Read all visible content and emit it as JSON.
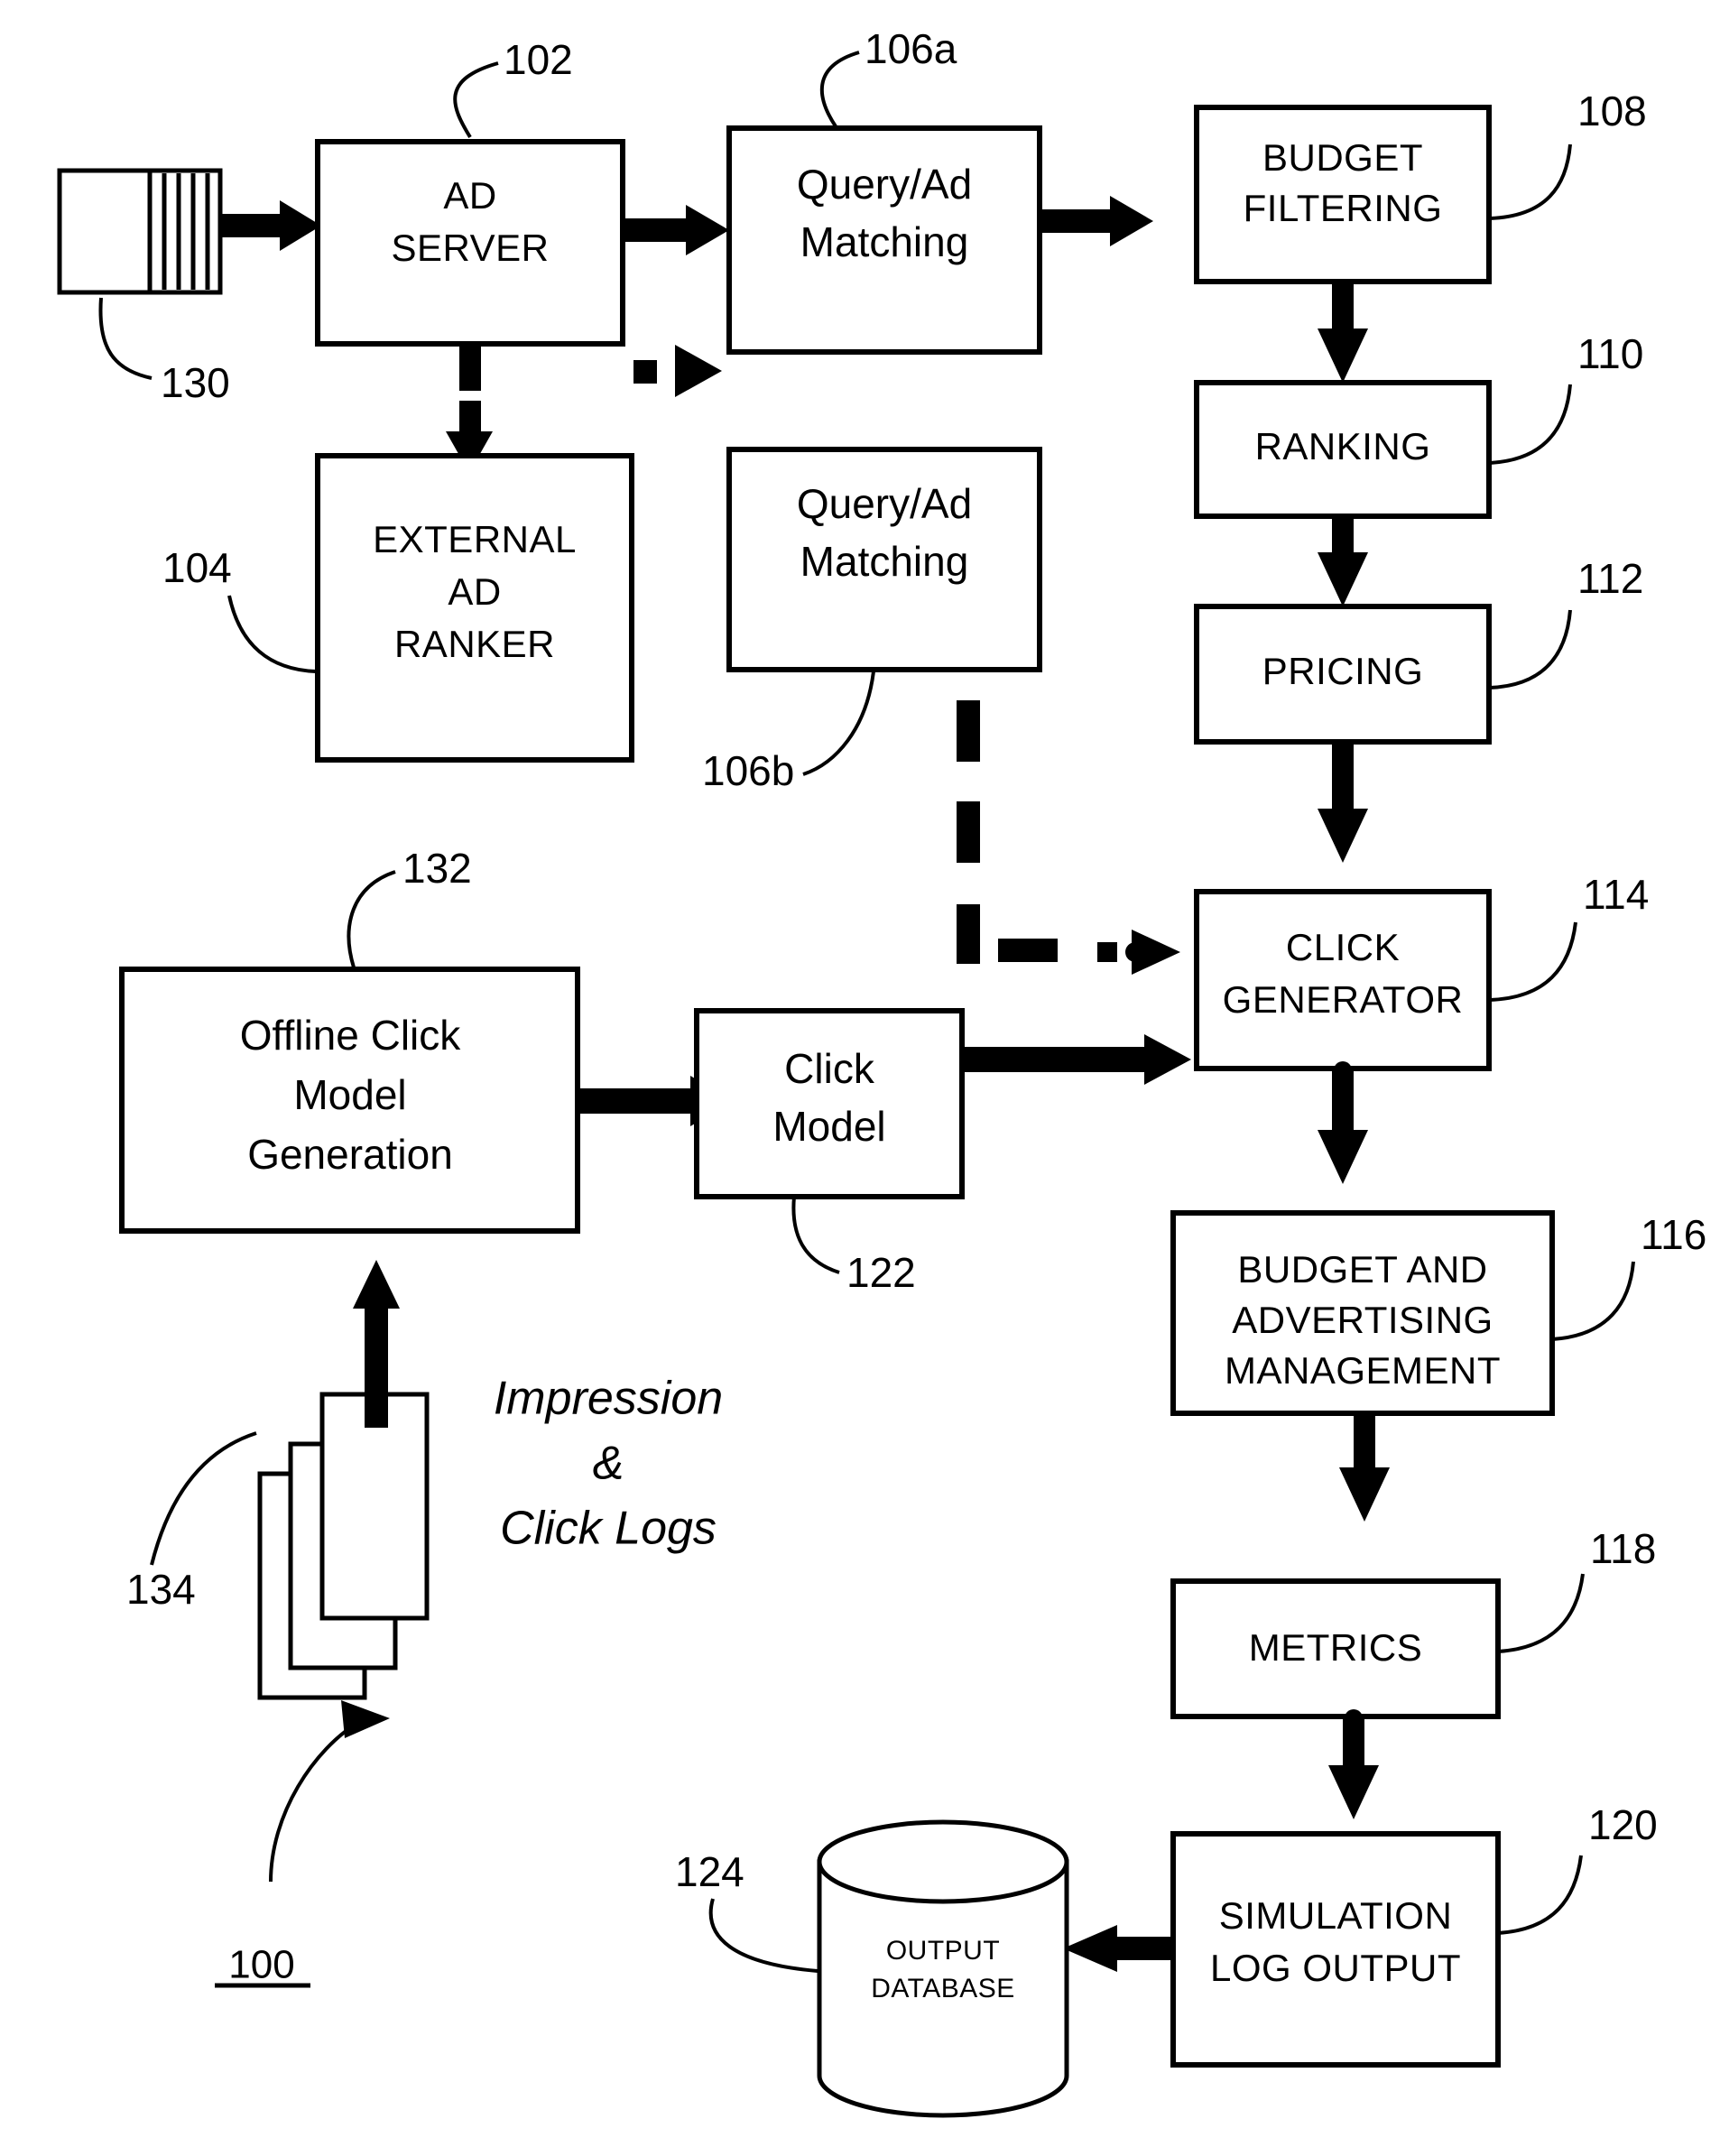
{
  "figure": {
    "number": "100",
    "type": "patent-block-diagram"
  },
  "nodes": {
    "input_docs": {
      "ref": "130",
      "label": ""
    },
    "ad_server": {
      "ref": "102",
      "label_line1": "AD",
      "label_line2": "SERVER"
    },
    "query_ad_matching_a": {
      "ref": "106a",
      "label_line1": "Query/Ad",
      "label_line2": "Matching"
    },
    "budget_filtering": {
      "ref": "108",
      "label_line1": "BUDGET",
      "label_line2": "FILTERING"
    },
    "external_ad_ranker": {
      "ref": "104",
      "label_line1": "EXTERNAL",
      "label_line2": "AD",
      "label_line3": "RANKER"
    },
    "query_ad_matching_b": {
      "ref": "106b",
      "label_line1": "Query/Ad",
      "label_line2": "Matching"
    },
    "ranking": {
      "ref": "110",
      "label": "RANKING"
    },
    "pricing": {
      "ref": "112",
      "label": "PRICING"
    },
    "click_generator": {
      "ref": "114",
      "label_line1": "CLICK",
      "label_line2": "GENERATOR"
    },
    "offline_click_model_generation": {
      "ref": "132",
      "label_line1": "Offline Click",
      "label_line2": "Model",
      "label_line3": "Generation"
    },
    "click_model": {
      "ref": "122",
      "label_line1": "Click",
      "label_line2": "Model"
    },
    "impression_click_logs": {
      "ref": "134",
      "label_line1": "Impression",
      "label_line2": "&",
      "label_line3": "Click Logs"
    },
    "budget_advertising_management": {
      "ref": "116",
      "label_line1": "BUDGET AND",
      "label_line2": "ADVERTISING",
      "label_line3": "MANAGEMENT"
    },
    "metrics": {
      "ref": "118",
      "label": "METRICS"
    },
    "simulation_log_output": {
      "ref": "120",
      "label_line1": "SIMULATION",
      "label_line2": "LOG OUTPUT"
    },
    "output_database": {
      "ref": "124",
      "label_line1": "OUTPUT",
      "label_line2": "DATABASE"
    }
  },
  "colors": {
    "stroke": "#000000",
    "fill": "#ffffff"
  }
}
